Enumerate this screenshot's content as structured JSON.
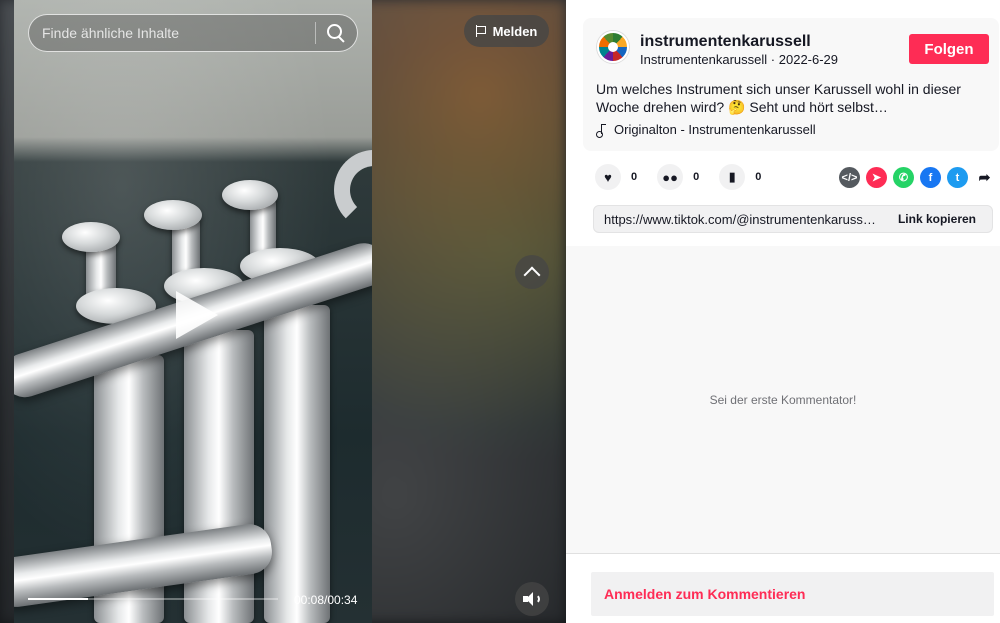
{
  "video": {
    "search_placeholder": "Finde ähnliche Inhalte",
    "report_label": "Melden",
    "time_label": "00:08/00:34",
    "progress_fraction": 0.24
  },
  "post": {
    "username": "instrumentenkarussell",
    "display_name": "Instrumentenkarussell",
    "date": "2022-6-29",
    "follow_label": "Folgen",
    "description": "Um welches Instrument sich unser Karussell wohl in dieser Woche drehen wird? 🤔 Seht und hört selbst…",
    "sound": "Originalton - Instrumentenkarussell"
  },
  "actions": {
    "likes": "0",
    "comments": "0",
    "saves": "0"
  },
  "share": {
    "icons": [
      "embed-icon",
      "send-icon",
      "whatsapp-icon",
      "facebook-icon",
      "twitter-icon",
      "share-arrow-icon"
    ],
    "colors": {
      "embed": "#555a5f",
      "send": "#fe2c55",
      "whatsapp": "#25d366",
      "facebook": "#1877f2",
      "twitter": "#1d9bf0"
    }
  },
  "link": {
    "url": "https://www.tiktok.com/@instrumentenkarussell/v...",
    "copy_label": "Link kopieren"
  },
  "comments": {
    "empty_text": "Sei der erste Kommentator!",
    "login_label": "Anmelden zum Kommentieren"
  },
  "colors": {
    "accent": "#fe2c55",
    "text": "#161823"
  }
}
